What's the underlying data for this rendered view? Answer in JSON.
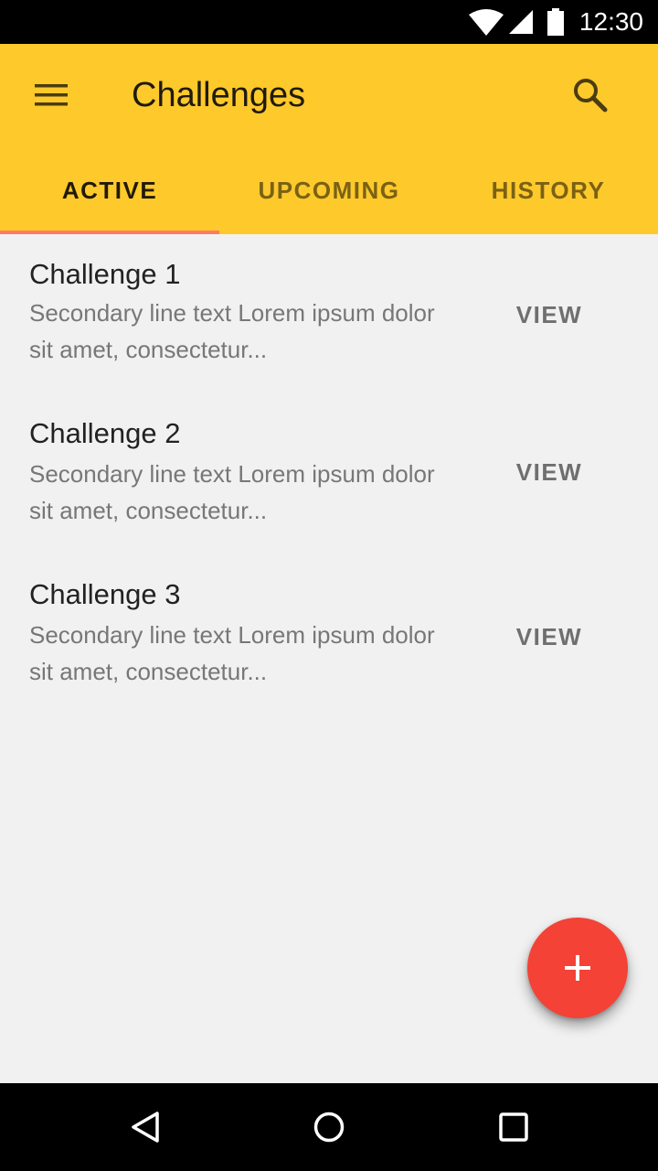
{
  "status_bar": {
    "time": "12:30",
    "icons": [
      "wifi-icon",
      "signal-icon",
      "battery-icon"
    ]
  },
  "app_bar": {
    "title": "Challenges",
    "menu_icon": "hamburger-menu-icon",
    "search_icon": "search-icon",
    "background_color": "#fec92b"
  },
  "tabs": [
    {
      "label": "ACTIVE",
      "selected": true
    },
    {
      "label": "UPCOMING",
      "selected": false
    },
    {
      "label": "HISTORY",
      "selected": false
    }
  ],
  "indicator_color": "#ff7a63",
  "items": [
    {
      "title": "Challenge 1",
      "secondary": "Secondary line text Lorem ipsum dolor sit amet, consectetur...",
      "action": "VIEW"
    },
    {
      "title": "Challenge 2",
      "secondary": "Secondary line text Lorem ipsum dolor sit amet, consectetur...",
      "action": "VIEW"
    },
    {
      "title": "Challenge 3",
      "secondary": "Secondary line text Lorem ipsum dolor sit amet, consectetur...",
      "action": "VIEW"
    }
  ],
  "fab": {
    "icon": "plus-icon",
    "color": "#f44236"
  },
  "nav_bar": {
    "icons": [
      "back-icon",
      "home-icon",
      "recents-icon"
    ]
  }
}
